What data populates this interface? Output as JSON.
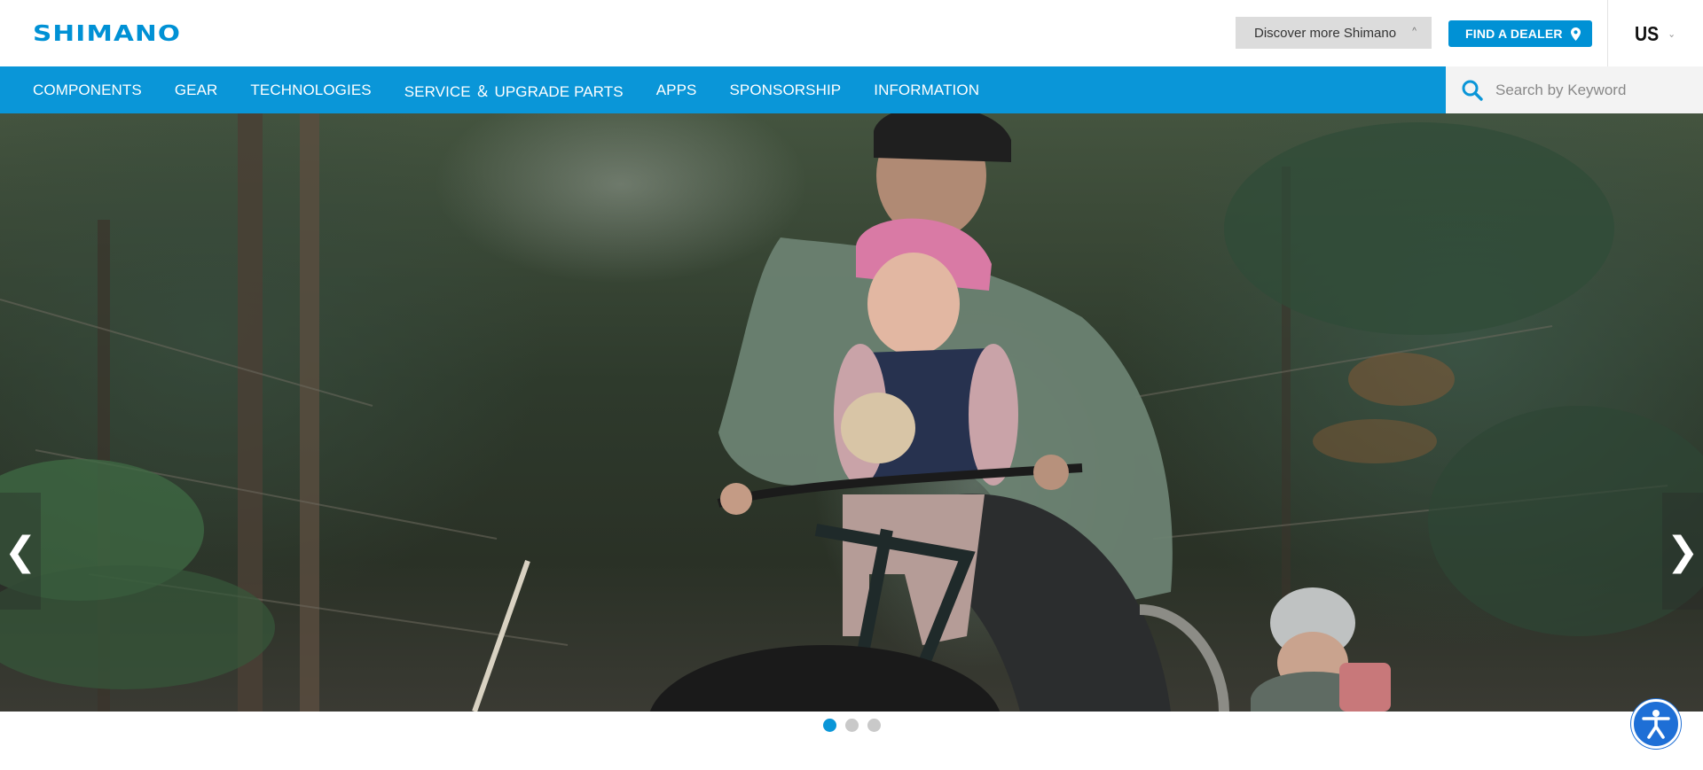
{
  "header": {
    "logo_text": "SHIMANO",
    "discover_label": "Discover more Shimano",
    "discover_caret": "^",
    "dealer_label": "FIND A DEALER",
    "dealer_icon": "map-pin-icon",
    "region_label": "US",
    "region_caret": "⌄"
  },
  "nav": {
    "items": [
      {
        "label": "COMPONENTS"
      },
      {
        "label": "GEAR"
      },
      {
        "label": "TECHNOLOGIES"
      },
      {
        "label": "SERVICE ＆ UPGRADE PARTS"
      },
      {
        "label": "APPS"
      },
      {
        "label": "SPONSORSHIP"
      },
      {
        "label": "INFORMATION"
      }
    ]
  },
  "search": {
    "placeholder": "Search by Keyword",
    "value": "",
    "icon": "search-icon"
  },
  "carousel": {
    "prev_label": "❮",
    "next_label": "❯",
    "slides_total": 3,
    "active_slide": 1
  },
  "accessibility": {
    "icon": "accessibility-icon"
  },
  "colors": {
    "brand": "#0091d5",
    "nav_bg": "#0a96d8",
    "accessibility_bg": "#1e6fd6"
  }
}
